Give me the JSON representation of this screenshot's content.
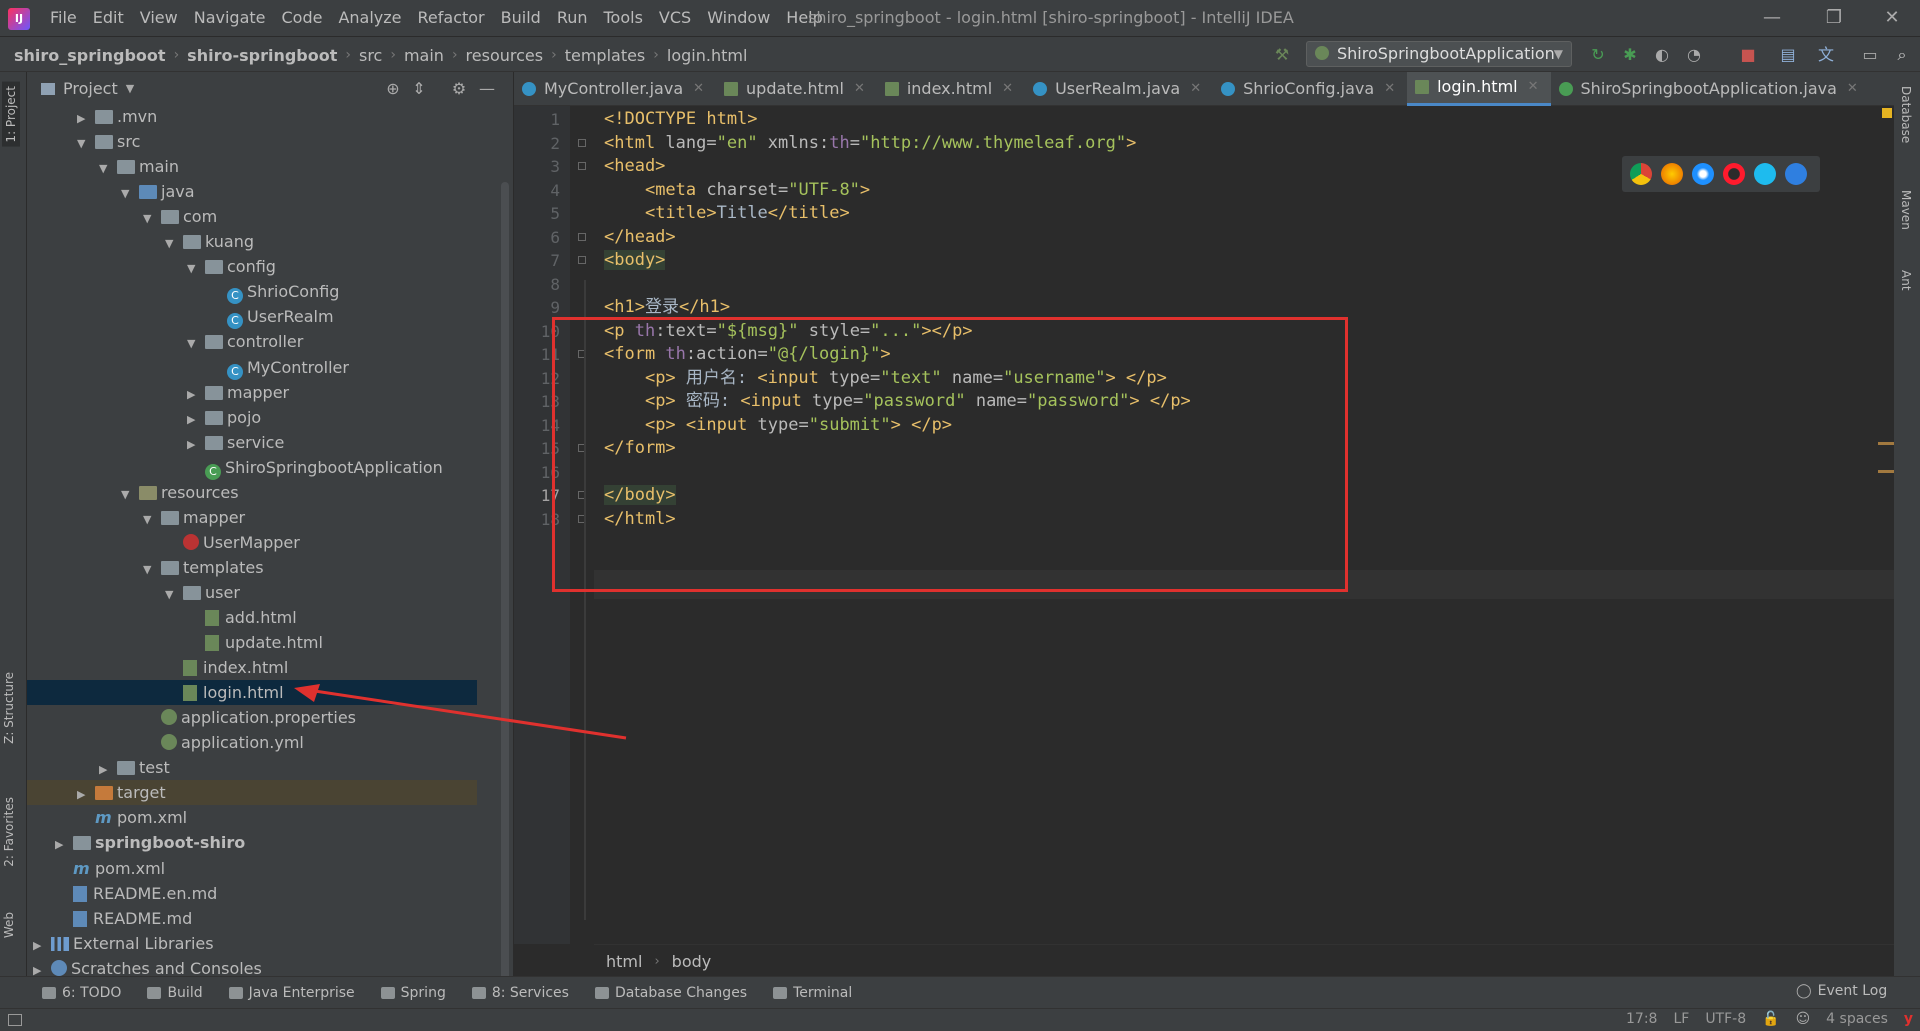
{
  "window": {
    "title": "shiro_springboot - login.html [shiro-springboot] - IntelliJ IDEA",
    "menus": [
      "File",
      "Edit",
      "View",
      "Navigate",
      "Code",
      "Analyze",
      "Refactor",
      "Build",
      "Run",
      "Tools",
      "VCS",
      "Window",
      "Help"
    ],
    "minimize": "—",
    "restore": "❐",
    "close": "✕"
  },
  "navbar": {
    "breadcrumbs": [
      "shiro_springboot",
      "shiro-springboot",
      "src",
      "main",
      "resources",
      "templates",
      "login.html"
    ],
    "run_config": "ShiroSpringbootApplication"
  },
  "left_strip": {
    "project_tab": "1: Project",
    "structure_tab": "Z: Structure",
    "favorites_tab": "2: Favorites",
    "web_tab": "Web"
  },
  "right_strip": {
    "database_tab": "Database",
    "maven_tab": "Maven",
    "ant_tab": "Ant"
  },
  "project_panel": {
    "title": "Project",
    "tree": [
      {
        "label": ".mvn",
        "depth": 2,
        "arrow": "▶",
        "icon": "folder"
      },
      {
        "label": "src",
        "depth": 2,
        "arrow": "▼",
        "icon": "folder"
      },
      {
        "label": "main",
        "depth": 3,
        "arrow": "▼",
        "icon": "folder"
      },
      {
        "label": "java",
        "depth": 4,
        "arrow": "▼",
        "icon": "folder-src"
      },
      {
        "label": "com",
        "depth": 5,
        "arrow": "▼",
        "icon": "package"
      },
      {
        "label": "kuang",
        "depth": 6,
        "arrow": "▼",
        "icon": "package"
      },
      {
        "label": "config",
        "depth": 7,
        "arrow": "▼",
        "icon": "package"
      },
      {
        "label": "ShrioConfig",
        "depth": 8,
        "arrow": "",
        "icon": "class"
      },
      {
        "label": "UserRealm",
        "depth": 8,
        "arrow": "",
        "icon": "class"
      },
      {
        "label": "controller",
        "depth": 7,
        "arrow": "▼",
        "icon": "package"
      },
      {
        "label": "MyController",
        "depth": 8,
        "arrow": "",
        "icon": "class"
      },
      {
        "label": "mapper",
        "depth": 7,
        "arrow": "▶",
        "icon": "package"
      },
      {
        "label": "pojo",
        "depth": 7,
        "arrow": "▶",
        "icon": "package"
      },
      {
        "label": "service",
        "depth": 7,
        "arrow": "▶",
        "icon": "package"
      },
      {
        "label": "ShiroSpringbootApplication",
        "depth": 7,
        "arrow": "",
        "icon": "spring-class"
      },
      {
        "label": "resources",
        "depth": 4,
        "arrow": "▼",
        "icon": "folder-res"
      },
      {
        "label": "mapper",
        "depth": 5,
        "arrow": "▼",
        "icon": "folder"
      },
      {
        "label": "UserMapper",
        "depth": 6,
        "arrow": "",
        "icon": "mybatis"
      },
      {
        "label": "templates",
        "depth": 5,
        "arrow": "▼",
        "icon": "folder"
      },
      {
        "label": "user",
        "depth": 6,
        "arrow": "▼",
        "icon": "folder"
      },
      {
        "label": "add.html",
        "depth": 7,
        "arrow": "",
        "icon": "html"
      },
      {
        "label": "update.html",
        "depth": 7,
        "arrow": "",
        "icon": "html"
      },
      {
        "label": "index.html",
        "depth": 6,
        "arrow": "",
        "icon": "html"
      },
      {
        "label": "login.html",
        "depth": 6,
        "arrow": "",
        "icon": "html",
        "selected": true
      },
      {
        "label": "application.properties",
        "depth": 5,
        "arrow": "",
        "icon": "spring-file"
      },
      {
        "label": "application.yml",
        "depth": 5,
        "arrow": "",
        "icon": "spring-file"
      },
      {
        "label": "test",
        "depth": 3,
        "arrow": "▶",
        "icon": "folder"
      },
      {
        "label": "target",
        "depth": 2,
        "arrow": "▶",
        "icon": "folder-target",
        "target": true
      },
      {
        "label": "pom.xml",
        "depth": 2,
        "arrow": "",
        "icon": "maven"
      },
      {
        "label": "springboot-shiro",
        "depth": 1,
        "arrow": "▶",
        "icon": "module",
        "bold": true
      },
      {
        "label": "pom.xml",
        "depth": 1,
        "arrow": "",
        "icon": "maven"
      },
      {
        "label": "README.en.md",
        "depth": 1,
        "arrow": "",
        "icon": "md"
      },
      {
        "label": "README.md",
        "depth": 1,
        "arrow": "",
        "icon": "md"
      },
      {
        "label": "External Libraries",
        "depth": 0,
        "arrow": "▶",
        "icon": "libs"
      },
      {
        "label": "Scratches and Consoles",
        "depth": 0,
        "arrow": "▶",
        "icon": "scratch"
      }
    ]
  },
  "tabs": [
    {
      "label": "MyController.java",
      "icon": "class"
    },
    {
      "label": "update.html",
      "icon": "html"
    },
    {
      "label": "index.html",
      "icon": "html"
    },
    {
      "label": "UserRealm.java",
      "icon": "class"
    },
    {
      "label": "ShrioConfig.java",
      "icon": "class"
    },
    {
      "label": "login.html",
      "icon": "html",
      "active": true
    },
    {
      "label": "ShiroSpringbootApplication.java",
      "icon": "spring-class"
    }
  ],
  "editor": {
    "line_numbers": [
      "1",
      "2",
      "3",
      "4",
      "5",
      "6",
      "7",
      "8",
      "9",
      "10",
      "11",
      "12",
      "13",
      "14",
      "15",
      "16",
      "17",
      "18"
    ],
    "current_line": "17",
    "lines": [
      [
        [
          "tag",
          "<!DOCTYPE html>"
        ]
      ],
      [
        [
          "tag",
          "<html "
        ],
        [
          "attr",
          "lang="
        ],
        [
          "val",
          "\"en\""
        ],
        [
          "attr",
          " xmlns:"
        ],
        [
          "ns",
          "th"
        ],
        [
          "attr",
          "="
        ],
        [
          "val",
          "\"http://www.thymeleaf.org\""
        ],
        [
          "tag",
          ">"
        ]
      ],
      [
        [
          "tag",
          "<head>"
        ]
      ],
      [
        [
          "txt",
          "    "
        ],
        [
          "tag",
          "<meta "
        ],
        [
          "attr",
          "charset="
        ],
        [
          "val",
          "\"UTF-8\""
        ],
        [
          "tag",
          ">"
        ]
      ],
      [
        [
          "txt",
          "    "
        ],
        [
          "tag",
          "<title>"
        ],
        [
          "txt",
          "Title"
        ],
        [
          "tag",
          "</title>"
        ]
      ],
      [
        [
          "tag",
          "</head>"
        ]
      ],
      [
        [
          "tag hl",
          "<body>"
        ]
      ],
      [
        [
          "txt",
          ""
        ]
      ],
      [
        [
          "tag",
          "<h1>"
        ],
        [
          "txt",
          "登录"
        ],
        [
          "tag",
          "</h1>"
        ]
      ],
      [
        [
          "tag",
          "<p "
        ],
        [
          "ns",
          "th"
        ],
        [
          "attr",
          ":text="
        ],
        [
          "val",
          "\"${msg}\""
        ],
        [
          "attr",
          " style="
        ],
        [
          "val",
          "\"...\""
        ],
        [
          "tag",
          "></p>"
        ]
      ],
      [
        [
          "tag",
          "<form "
        ],
        [
          "ns",
          "th"
        ],
        [
          "attr",
          ":action="
        ],
        [
          "val",
          "\"@{/login}\""
        ],
        [
          "tag",
          ">"
        ]
      ],
      [
        [
          "txt",
          "    "
        ],
        [
          "tag",
          "<p>"
        ],
        [
          "txt",
          " 用户名: "
        ],
        [
          "tag",
          "<input "
        ],
        [
          "attr",
          "type="
        ],
        [
          "val",
          "\"text\""
        ],
        [
          "attr",
          " name="
        ],
        [
          "val",
          "\"username\""
        ],
        [
          "tag",
          "> </p>"
        ]
      ],
      [
        [
          "txt",
          "    "
        ],
        [
          "tag",
          "<p>"
        ],
        [
          "txt",
          " 密码: "
        ],
        [
          "tag",
          "<input "
        ],
        [
          "attr",
          "type="
        ],
        [
          "val",
          "\"password\""
        ],
        [
          "attr",
          " name="
        ],
        [
          "val",
          "\"password\""
        ],
        [
          "tag",
          "> </p>"
        ]
      ],
      [
        [
          "txt",
          "    "
        ],
        [
          "tag",
          "<p> <input "
        ],
        [
          "attr",
          "type="
        ],
        [
          "val",
          "\"submit\""
        ],
        [
          "tag",
          "> </p>"
        ]
      ],
      [
        [
          "tag",
          "</form>"
        ]
      ],
      [
        [
          "txt",
          ""
        ]
      ],
      [
        [
          "tag hl",
          "</body>"
        ]
      ],
      [
        [
          "tag",
          "</html>"
        ]
      ]
    ],
    "breadcrumb": [
      "html",
      "body"
    ]
  },
  "bottom_tools": [
    "6: TODO",
    "Build",
    "Java Enterprise",
    "Spring",
    "8: Services",
    "Database Changes",
    "Terminal"
  ],
  "event_log": "Event Log",
  "status": {
    "position": "17:8",
    "line_sep": "LF",
    "encoding": "UTF-8",
    "indent": "4 spaces"
  }
}
